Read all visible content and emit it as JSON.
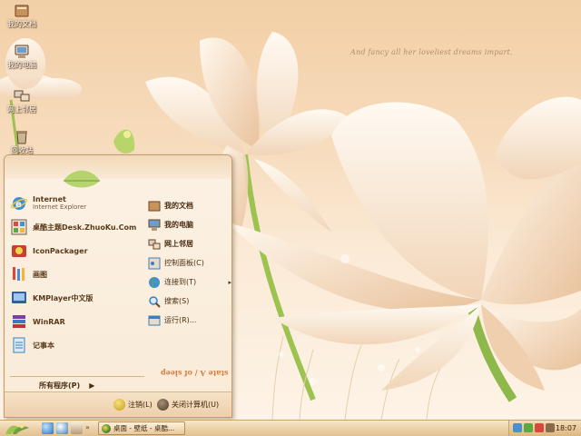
{
  "wallpaper": {
    "quote": "And fancy all her loveliest dreams impart."
  },
  "desktop_icons": [
    {
      "label": "我的文档",
      "icon": "my-documents-icon"
    },
    {
      "label": "我的电脑",
      "icon": "my-computer-icon"
    },
    {
      "label": "网上邻居",
      "icon": "network-places-icon"
    },
    {
      "label": "回收站",
      "icon": "recycle-bin-icon"
    }
  ],
  "start_menu": {
    "pinned": [
      {
        "title": "Internet",
        "subtitle": "Internet Explorer",
        "icon": "internet-explorer-icon"
      },
      {
        "title": "桌酷主题Desk.ZhuoKu.Com",
        "icon": "zhuoku-theme-icon"
      },
      {
        "title": "IconPackager",
        "icon": "iconpackager-icon"
      },
      {
        "title": "画图",
        "icon": "paint-icon"
      },
      {
        "title": "KMPlayer中文版",
        "icon": "kmplayer-icon"
      },
      {
        "title": "WinRAR",
        "icon": "winrar-icon"
      },
      {
        "title": "记事本",
        "icon": "notepad-icon"
      }
    ],
    "places": [
      {
        "label": "我的文档",
        "icon": "my-documents-icon",
        "bold": true
      },
      {
        "label": "我的电脑",
        "icon": "my-computer-icon",
        "bold": true
      },
      {
        "label": "网上邻居",
        "icon": "network-places-icon",
        "bold": true
      },
      {
        "label": "控制面板(C)",
        "icon": "control-panel-icon",
        "bold": false
      },
      {
        "label": "连接到(T)",
        "icon": "connect-to-icon",
        "bold": false,
        "submenu": true
      },
      {
        "label": "搜索(S)",
        "icon": "search-icon",
        "bold": false
      },
      {
        "label": "运行(R)...",
        "icon": "run-icon",
        "bold": false
      }
    ],
    "all_programs": "所有程序(P)",
    "stamp": "state A / of sleep",
    "logoff": "注销(L)",
    "shutdown": "关闭计算机(U)"
  },
  "taskbar": {
    "task": "桌面 - 壁纸 - 桌酷...",
    "clock": "18:07"
  },
  "colors": {
    "wallpaper_top": "#f2cfa6",
    "petal": "#fdf3ea",
    "stem": "#8fb84a",
    "menu_text": "#4a2e12",
    "taskbar": "#ecd2aa"
  }
}
